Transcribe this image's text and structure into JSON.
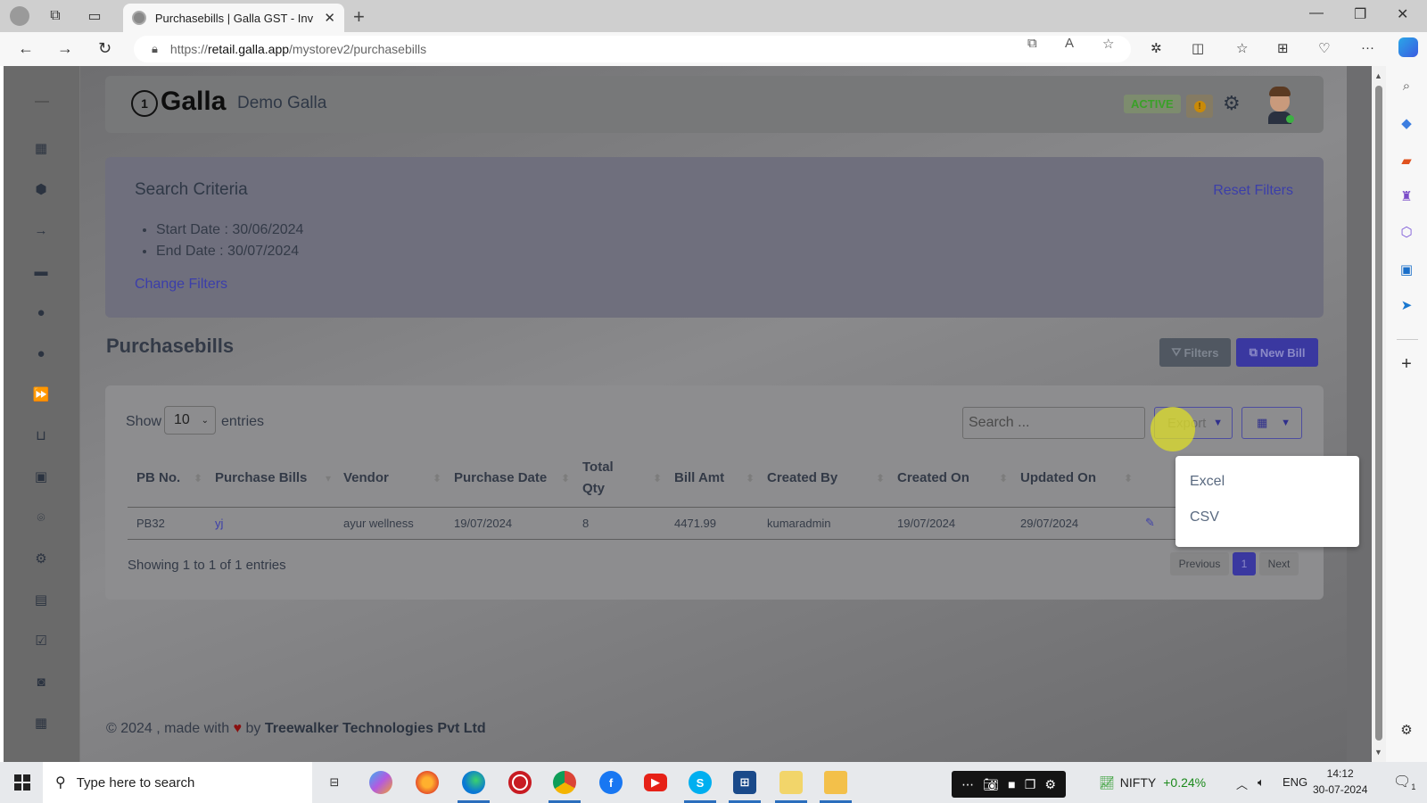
{
  "browser": {
    "tab_title": "Purchasebills | Galla GST - Inventory",
    "url_prefix": "https://",
    "url_host": "retail.galla.app",
    "url_path": "/mystorev2/purchasebills",
    "new_tab": "+",
    "window_controls": {
      "minimize": "—",
      "restore": "❐",
      "close": "✕"
    }
  },
  "header": {
    "logo_mark": "1",
    "logo_text": "Galla",
    "store_name": "Demo Galla",
    "status_badge": "ACTIVE",
    "warning": "!"
  },
  "sidebar": {
    "items": [
      {
        "icon": "dashboard-icon",
        "glyph": "▦"
      },
      {
        "icon": "box-icon",
        "glyph": "⬢"
      },
      {
        "icon": "arrow-right-icon",
        "glyph": "→"
      },
      {
        "icon": "coupon-icon",
        "glyph": "▬"
      },
      {
        "icon": "user-circle-icon",
        "glyph": "●"
      },
      {
        "icon": "user-circle-icon-2",
        "glyph": "●"
      },
      {
        "icon": "fast-forward-icon",
        "glyph": "⏩"
      },
      {
        "icon": "basket-icon",
        "glyph": "⊔"
      },
      {
        "icon": "contacts-icon",
        "glyph": "▣"
      },
      {
        "icon": "location-pin-icon",
        "glyph": "⌾"
      },
      {
        "icon": "settings-icon",
        "glyph": "⚙"
      },
      {
        "icon": "report-icon",
        "glyph": "▤"
      },
      {
        "icon": "checkbox-icon",
        "glyph": "☑"
      },
      {
        "icon": "cash-icon",
        "glyph": "◙"
      },
      {
        "icon": "calendar-icon",
        "glyph": "▦"
      }
    ]
  },
  "criteria": {
    "title": "Search Criteria",
    "items": [
      "Start Date : 30/06/2024",
      "End Date : 30/07/2024"
    ],
    "change_filters": "Change Filters",
    "reset_filters": "Reset Filters"
  },
  "main": {
    "page_title": "Purchasebills",
    "filters_button": "Filters",
    "new_bill_button": "New Bill",
    "show_label": "Show",
    "page_size": "10",
    "entries_label": "entries",
    "search_placeholder": "Search ...",
    "export_button": "Export",
    "export_menu": [
      "Excel",
      "CSV"
    ],
    "table": {
      "columns": [
        "PB No.",
        "Purchase Bills",
        "Vendor",
        "Purchase Date",
        "Total Qty",
        "Bill Amt",
        "Created By",
        "Created On",
        "Updated On"
      ],
      "rows": [
        [
          "PB32",
          "yj",
          "ayur wellness",
          "19/07/2024",
          "8",
          "4471.99",
          "kumaradmin",
          "19/07/2024",
          "29/07/2024"
        ]
      ]
    },
    "showing_text": "Showing 1 to 1 of 1 entries",
    "pagination": {
      "previous": "Previous",
      "current": "1",
      "next": "Next"
    }
  },
  "footer": {
    "prefix": "© 2024 , made with",
    "heart": "♥",
    "by": "by",
    "company": "Treewalker Technologies Pvt Ltd"
  },
  "taskbar": {
    "search_placeholder": "Type here to search",
    "nifty_label": "NIFTY",
    "nifty_change": "+0.24%",
    "language": "ENG",
    "time": "14:12",
    "date": "30-07-2024",
    "notifications": "1"
  },
  "colors": {
    "accent": "#3a38a0",
    "active_green": "#3aa029",
    "link": "#3b3eaa"
  }
}
